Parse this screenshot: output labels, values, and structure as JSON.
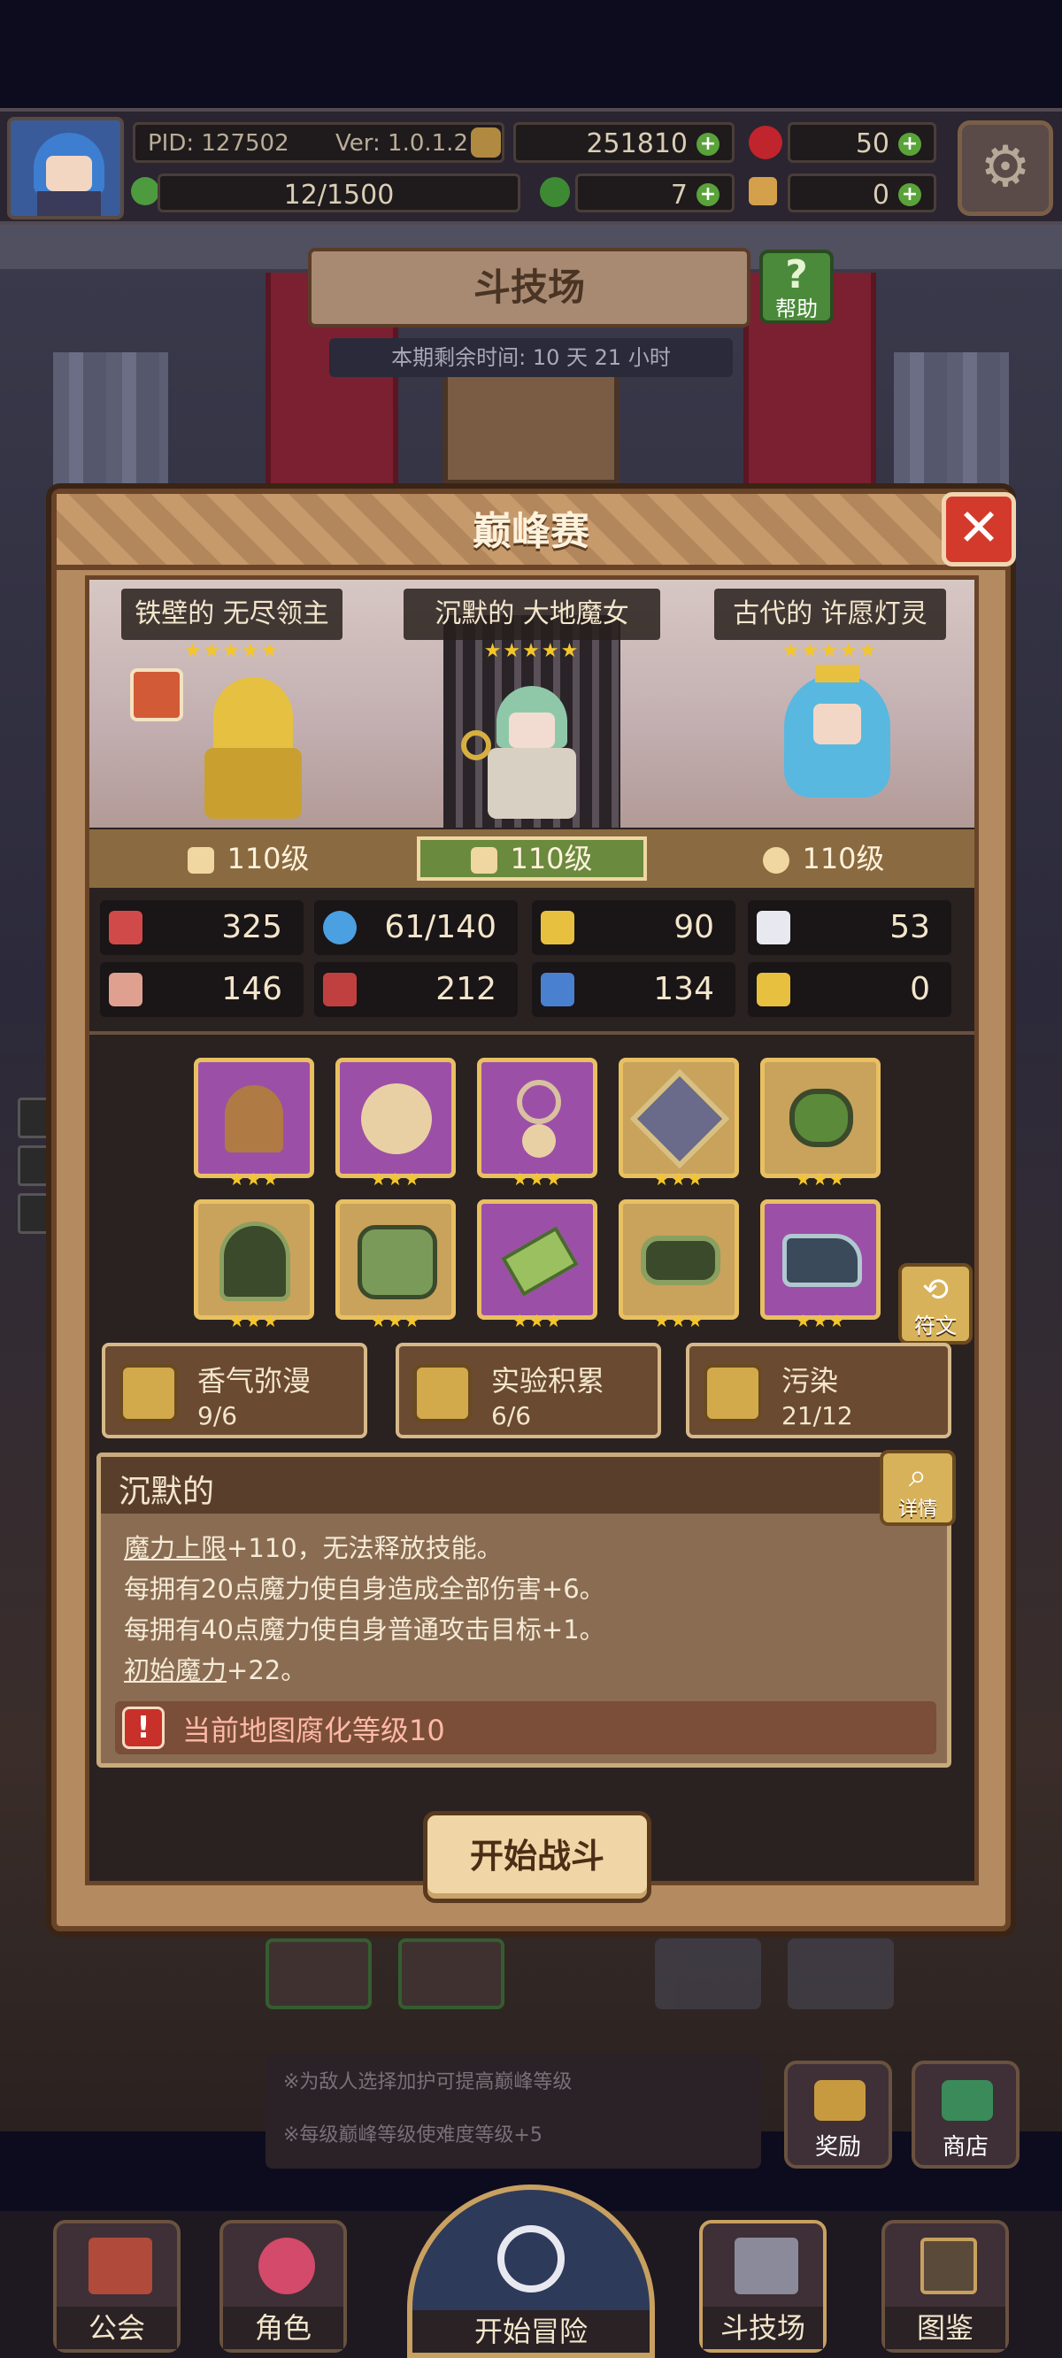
{
  "topbar": {
    "pid": "PID: 127502",
    "version": "Ver: 1.0.1.2",
    "gold": "251810",
    "gems": "50",
    "exp": "12/1500",
    "clover": "7",
    "key": "0"
  },
  "arena": {
    "title": "斗技场",
    "help_label": "帮助",
    "remaining": "本期剩余时间: 10 天 21 小时"
  },
  "dialog": {
    "title": "巅峰赛",
    "heroes": [
      {
        "name": "铁壁的 无尽领主",
        "stars": "★★★★★",
        "level": "110级"
      },
      {
        "name": "沉默的 大地魔女",
        "stars": "★★★★★",
        "level": "110级"
      },
      {
        "name": "古代的 许愿灯灵",
        "stars": "★★★★★",
        "level": "110级"
      }
    ],
    "stats": [
      {
        "icon": "heart-icon",
        "value": "325"
      },
      {
        "icon": "mana-drop-icon",
        "value": "61/140"
      },
      {
        "icon": "shield-icon",
        "value": "90"
      },
      {
        "icon": "wing-icon",
        "value": "53"
      },
      {
        "icon": "fist-icon",
        "value": "146"
      },
      {
        "icon": "spellbook-icon",
        "value": "212"
      },
      {
        "icon": "boot-icon",
        "value": "134"
      },
      {
        "icon": "horseshoe-icon",
        "value": "0"
      }
    ],
    "items": [
      {
        "icon": "staff-icon",
        "stars": "★★★"
      },
      {
        "icon": "orb-icon",
        "stars": "★★★"
      },
      {
        "icon": "amulet-icon",
        "stars": "★★★"
      },
      {
        "icon": "crystal-ring-icon",
        "stars": "★★★"
      },
      {
        "icon": "green-ring-icon",
        "stars": "★★★"
      },
      {
        "icon": "helmet-icon",
        "stars": "★★★"
      },
      {
        "icon": "armor-icon",
        "stars": "★★★"
      },
      {
        "icon": "bracer-icon",
        "stars": "★★★"
      },
      {
        "icon": "belt-icon",
        "stars": "★★★"
      },
      {
        "icon": "boots-icon",
        "stars": "★★★"
      }
    ],
    "rune_label": "符文",
    "traits": [
      {
        "name": "香气弥漫",
        "count": "9/6"
      },
      {
        "name": "实验积累",
        "count": "6/6"
      },
      {
        "name": "污染",
        "count": "21/12"
      }
    ],
    "desc": {
      "title": "沉默的",
      "detail_label": "详情",
      "line1_link": "魔力上限",
      "line1_rest": "+110，无法释放技能。",
      "line2": "每拥有20点魔力使自身造成全部伤害+6。",
      "line3": "每拥有40点魔力使自身普通攻击目标+1。",
      "line4_link": "初始魔力",
      "line4_rest": "+22。",
      "warning": "当前地图腐化等级10"
    },
    "start_button": "开始战斗"
  },
  "background_notes": {
    "note1": "※为敌人选择加护可提高巅峰等级",
    "note2": "※每级巅峰等级使难度等级+5",
    "reward": "奖励",
    "shop": "商店"
  },
  "nav": {
    "guild": "公会",
    "character": "角色",
    "adventure": "开始冒险",
    "arena": "斗技场",
    "codex": "图鉴"
  }
}
